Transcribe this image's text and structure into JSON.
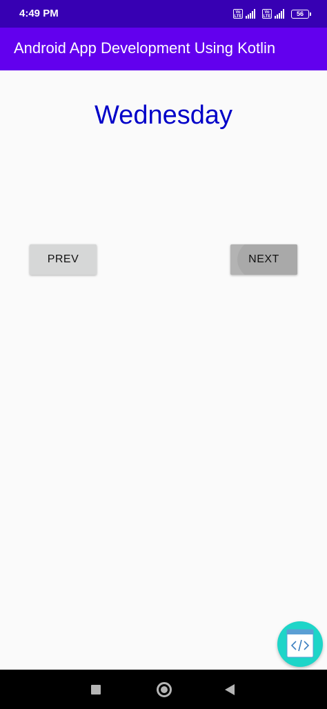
{
  "status_bar": {
    "time": "4:49 PM",
    "volte_label": "Vo LTE",
    "battery_level": "56"
  },
  "app_bar": {
    "title": "Android App Development Using Kotlin"
  },
  "main": {
    "day_text": "Wednesday",
    "prev_label": "PREV",
    "next_label": "NEXT"
  },
  "fab": {
    "icon": "code-icon"
  },
  "colors": {
    "status_bar": "#3700b3",
    "app_bar": "#6200ee",
    "day_text": "#0000c8",
    "button": "#d6d7d7",
    "fab": "#1ed5c8",
    "nav_bar": "#000000"
  }
}
